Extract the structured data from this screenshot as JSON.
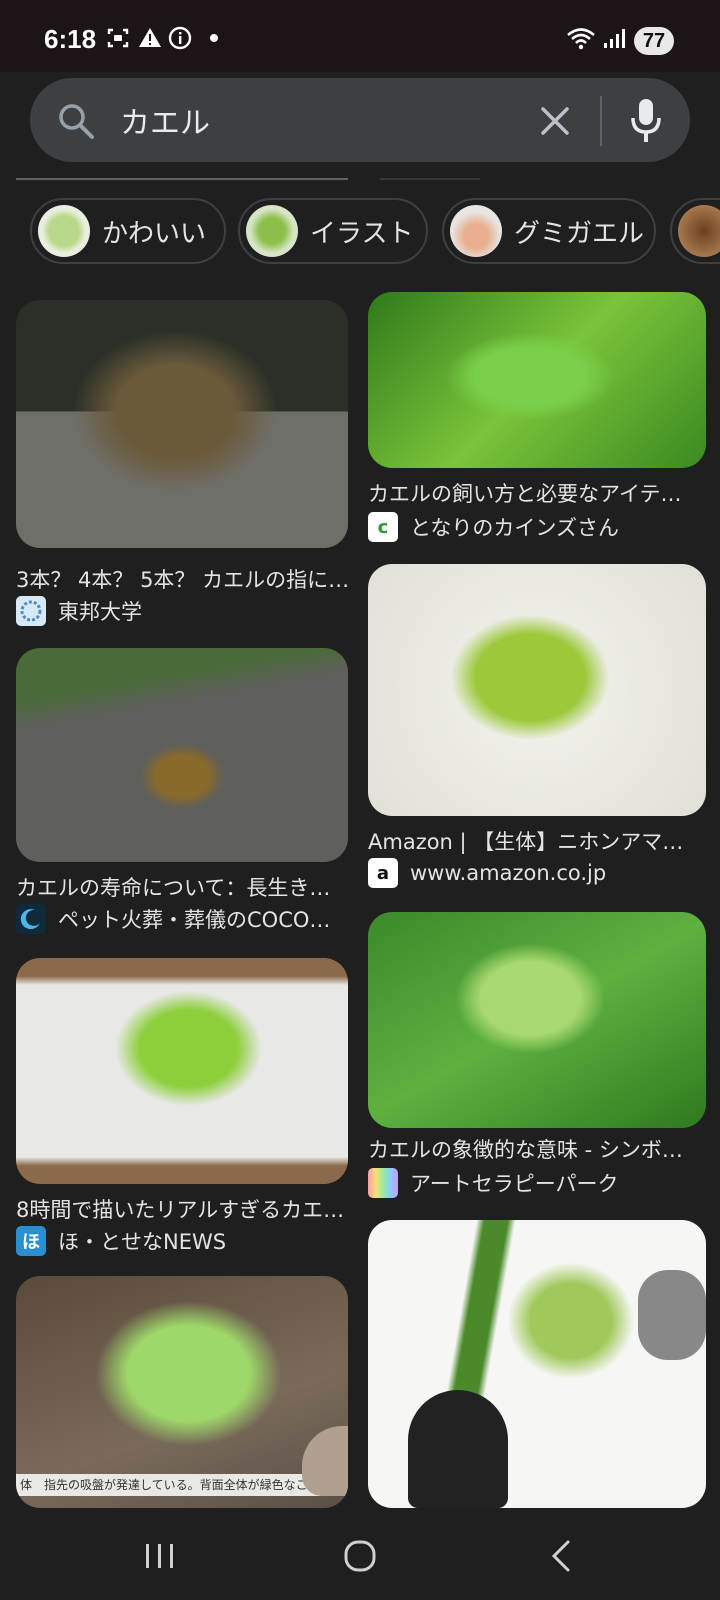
{
  "status_bar": {
    "time": "6:18",
    "battery": "77",
    "icons": [
      "screenshot-icon",
      "warning-icon",
      "info-icon",
      "dot-icon",
      "wifi-icon",
      "signal-icon"
    ]
  },
  "search": {
    "query": "カエル"
  },
  "chips": [
    {
      "label": "かわいい"
    },
    {
      "label": "イラスト"
    },
    {
      "label": "グミガエル"
    }
  ],
  "results_left": [
    {
      "title": "3本？ 4本？ 5本？ カエルの指に…",
      "source": "東邦大学"
    },
    {
      "title": "カエルの寿命について：長生き…",
      "source": "ペット火葬・葬儀のCOCO…"
    },
    {
      "title": "8時間で描いたリアルすぎるカエ…",
      "source": "ほ・とせなNEWS",
      "favicon_text": "ほ"
    },
    {
      "caption": "体　指先の吸盤が発達している。背面全体が緑色なこと"
    }
  ],
  "results_right": [
    {
      "title": "カエルの飼い方と必要なアイテ…",
      "source": "となりのカインズさん",
      "favicon_text": "c"
    },
    {
      "title": "Amazon | 【生体】ニホンアマ…",
      "source": "www.amazon.co.jp",
      "favicon_text": "a"
    },
    {
      "title": "カエルの象徴的な意味 - シンボ…",
      "source": "アートセラピーパーク"
    },
    {}
  ],
  "colors": {
    "background": "#1f1f1f",
    "search_box": "#3c4043",
    "status_bar": "#1c1416"
  }
}
